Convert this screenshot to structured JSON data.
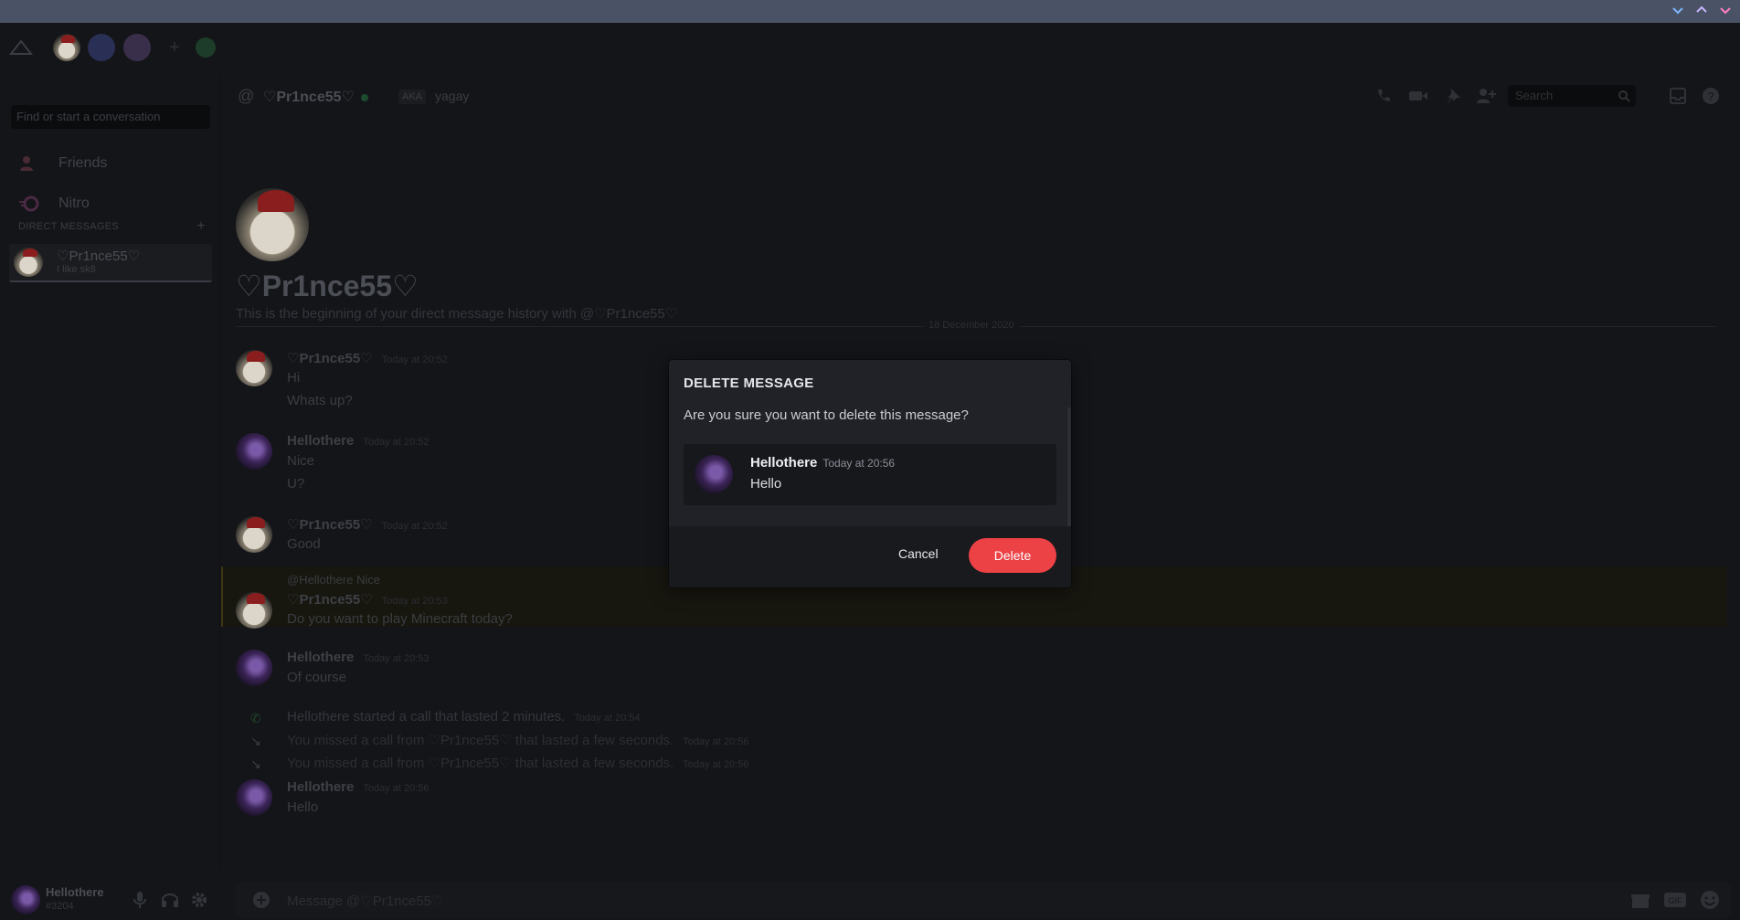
{
  "sidebar": {
    "search_placeholder": "Find or start a conversation",
    "nav": [
      {
        "label": "Friends",
        "icon": "friends-icon"
      },
      {
        "label": "Nitro",
        "icon": "nitro-icon"
      }
    ],
    "dm_header": "DIRECT MESSAGES",
    "dm_add": "+",
    "dm": {
      "name": "♡Pr1nce55♡",
      "status": "I like sk8"
    }
  },
  "header": {
    "channel_name": "♡Pr1nce55♡",
    "aka_label": "AKA",
    "aka_value": "yagay",
    "search_placeholder": "Search"
  },
  "intro": {
    "title": "♡Pr1nce55♡",
    "text": "This is the beginning of your direct message history with @♡Pr1nce55♡",
    "date_divider": "18 December 2020"
  },
  "messages": [
    {
      "name": "♡Pr1nce55♡",
      "time": "Today at 20:52",
      "lines": [
        "Hi",
        "Whats up?"
      ]
    },
    {
      "name": "Hellothere",
      "time": "Today at 20:52",
      "lines": [
        "Nice",
        "U?"
      ]
    },
    {
      "name": "♡Pr1nce55♡",
      "time": "Today at 20:52",
      "lines": [
        "Good"
      ]
    },
    {
      "reply": "@Hellothere Nice",
      "name": "♡Pr1nce55♡",
      "time": "Today at 20:53",
      "lines": [
        "Do you want to play Minecraft today?"
      ]
    },
    {
      "name": "Hellothere",
      "time": "Today at 20:53",
      "lines": [
        "Of course"
      ]
    },
    {
      "system": "Hellothere started a call that lasted 2 minutes.",
      "time": "Today at 20:54"
    },
    {
      "system": "You missed a call from ♡Pr1nce55♡ that lasted a few seconds.",
      "time": "Today at 20:56"
    },
    {
      "system": "You missed a call from ♡Pr1nce55♡ that lasted a few seconds.",
      "time": "Today at 20:56"
    },
    {
      "name": "Hellothere",
      "time": "Today at 20:56",
      "lines": [
        "Hello"
      ]
    }
  ],
  "composer": {
    "placeholder": "Message @♡Pr1nce55♡"
  },
  "user_panel": {
    "name": "Hellothere",
    "tag": "#3204"
  },
  "modal": {
    "title": "DELETE MESSAGE",
    "body": "Are you sure you want to delete this message?",
    "preview": {
      "name": "Hellothere",
      "time": "Today at 20:56",
      "text": "Hello"
    },
    "cancel_label": "Cancel",
    "delete_label": "Delete",
    "delete_color": "#ec4145"
  },
  "colors": {
    "titlebar": "#4a5366",
    "background": "#141519",
    "modal": "#202227"
  }
}
